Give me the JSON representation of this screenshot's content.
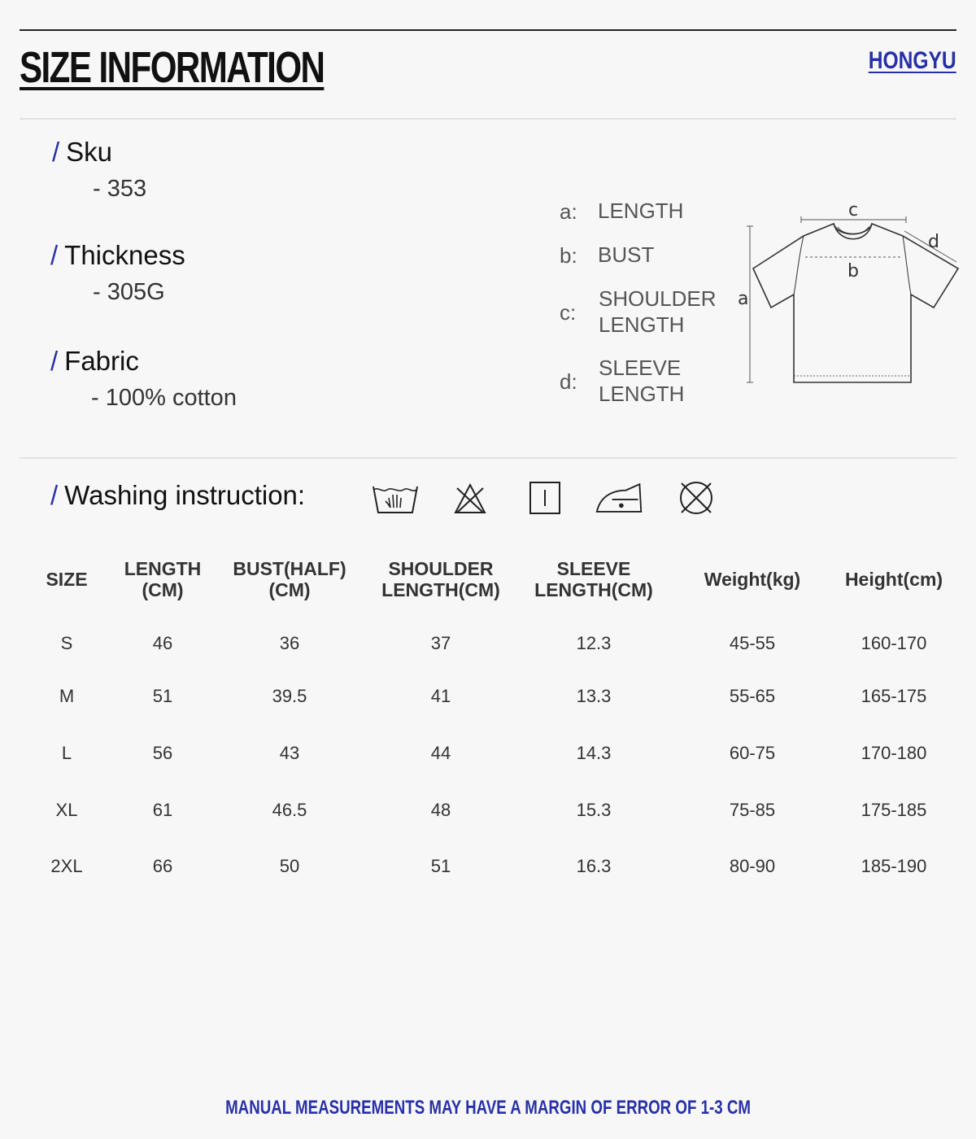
{
  "header": {
    "title": "SIZE INFORMATION",
    "brand": "HONGYU"
  },
  "specs": [
    {
      "label": "Sku",
      "value": "- 353"
    },
    {
      "label": "Thickness",
      "value": "- 305G"
    },
    {
      "label": "Fabric",
      "value": "- 100% cotton"
    }
  ],
  "legend": [
    {
      "key": "a:",
      "text": "LENGTH"
    },
    {
      "key": "b:",
      "text": "BUST"
    },
    {
      "key": "c:",
      "text": "SHOULDER LENGTH"
    },
    {
      "key": "d:",
      "text": "SLEEVE LENGTH"
    }
  ],
  "diagram_labels": {
    "a": "a",
    "b": "b",
    "c": "c",
    "d": "d"
  },
  "washing": {
    "label": "Washing instruction:",
    "icons": [
      "hand-wash-icon",
      "do-not-bleach-icon",
      "hang-dry-icon",
      "iron-low-heat-icon",
      "do-not-dry-clean-icon"
    ]
  },
  "table": {
    "headers": [
      "SIZE",
      "LENGTH (CM)",
      "BUST(HALF) (CM)",
      "SHOULDER LENGTH(CM)",
      "SLEEVE LENGTH(CM)",
      "Weight(kg)",
      "Height(cm)"
    ],
    "rows": [
      [
        "S",
        "46",
        "36",
        "37",
        "12.3",
        "45-55",
        "160-170"
      ],
      [
        "M",
        "51",
        "39.5",
        "41",
        "13.3",
        "55-65",
        "165-175"
      ],
      [
        "L",
        "56",
        "43",
        "44",
        "14.3",
        "60-75",
        "170-180"
      ],
      [
        "XL",
        "61",
        "46.5",
        "48",
        "15.3",
        "75-85",
        "175-185"
      ],
      [
        "2XL",
        "66",
        "50",
        "51",
        "16.3",
        "80-90",
        "185-190"
      ]
    ]
  },
  "footer": {
    "disclaimer": "MANUAL MEASUREMENTS MAY HAVE A MARGIN OF ERROR OF 1-3 CM"
  },
  "colors": {
    "accent": "#2730a8",
    "background": "#f7f7f7",
    "text": "#1a1a1a"
  }
}
